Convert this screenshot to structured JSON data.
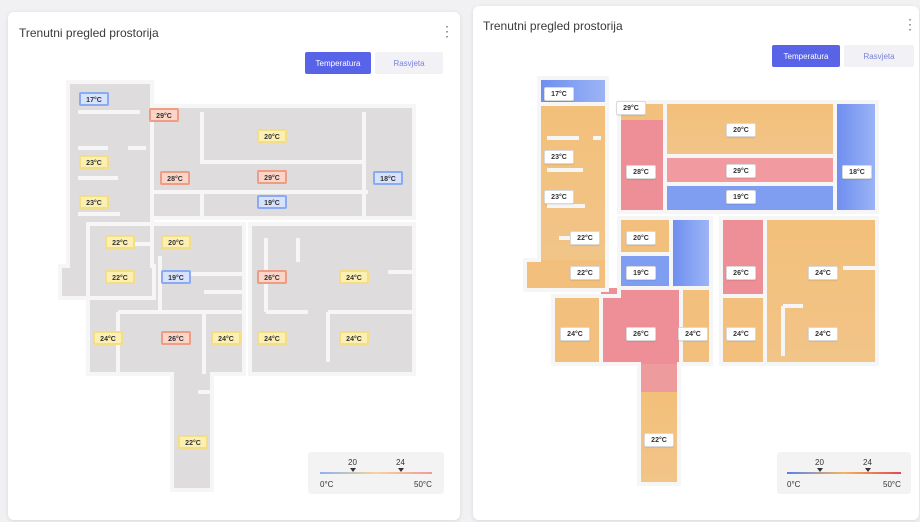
{
  "left_card": {
    "title": "Trenutni pregled prostorija",
    "tabs": [
      {
        "label": "Temperatura",
        "active": true
      },
      {
        "label": "Rasvjeta",
        "active": false
      }
    ],
    "rooms": [
      {
        "label": "17°C",
        "scale": "cold"
      },
      {
        "label": "29°C",
        "scale": "hot"
      },
      {
        "label": "20°C",
        "scale": "mid"
      },
      {
        "label": "23°C",
        "scale": "mid"
      },
      {
        "label": "28°C",
        "scale": "hot"
      },
      {
        "label": "29°C",
        "scale": "hot"
      },
      {
        "label": "18°C",
        "scale": "cold"
      },
      {
        "label": "23°C",
        "scale": "mid"
      },
      {
        "label": "19°C",
        "scale": "cold"
      },
      {
        "label": "22°C",
        "scale": "mid"
      },
      {
        "label": "20°C",
        "scale": "mid"
      },
      {
        "label": "22°C",
        "scale": "mid"
      },
      {
        "label": "19°C",
        "scale": "cold"
      },
      {
        "label": "26°C",
        "scale": "hot"
      },
      {
        "label": "24°C",
        "scale": "mid"
      },
      {
        "label": "24°C",
        "scale": "mid"
      },
      {
        "label": "26°C",
        "scale": "hot"
      },
      {
        "label": "24°C",
        "scale": "mid"
      },
      {
        "label": "24°C",
        "scale": "mid"
      },
      {
        "label": "24°C",
        "scale": "mid"
      },
      {
        "label": "22°C",
        "scale": "mid"
      }
    ],
    "legend": {
      "low_mark": "20",
      "high_mark": "24",
      "min": "0°C",
      "max": "50°C"
    }
  },
  "right_card": {
    "title": "Trenutni pregled prostorija",
    "tabs": [
      {
        "label": "Temperatura",
        "active": true
      },
      {
        "label": "Rasvjeta",
        "active": false
      }
    ],
    "rooms": [
      {
        "label": "17°C"
      },
      {
        "label": "29°C"
      },
      {
        "label": "20°C"
      },
      {
        "label": "23°C"
      },
      {
        "label": "28°C"
      },
      {
        "label": "29°C"
      },
      {
        "label": "18°C"
      },
      {
        "label": "23°C"
      },
      {
        "label": "19°C"
      },
      {
        "label": "22°C"
      },
      {
        "label": "20°C"
      },
      {
        "label": "22°C"
      },
      {
        "label": "19°C"
      },
      {
        "label": "26°C"
      },
      {
        "label": "24°C"
      },
      {
        "label": "24°C"
      },
      {
        "label": "26°C"
      },
      {
        "label": "24°C"
      },
      {
        "label": "24°C"
      },
      {
        "label": "24°C"
      },
      {
        "label": "22°C"
      }
    ],
    "legend": {
      "low_mark": "20",
      "high_mark": "24",
      "min": "0°C",
      "max": "50°C"
    }
  },
  "colors": {
    "accent": "#5963e8",
    "cold": "#7e9ff0",
    "mid": "#f2c27c",
    "hot": "#ec8c92"
  }
}
